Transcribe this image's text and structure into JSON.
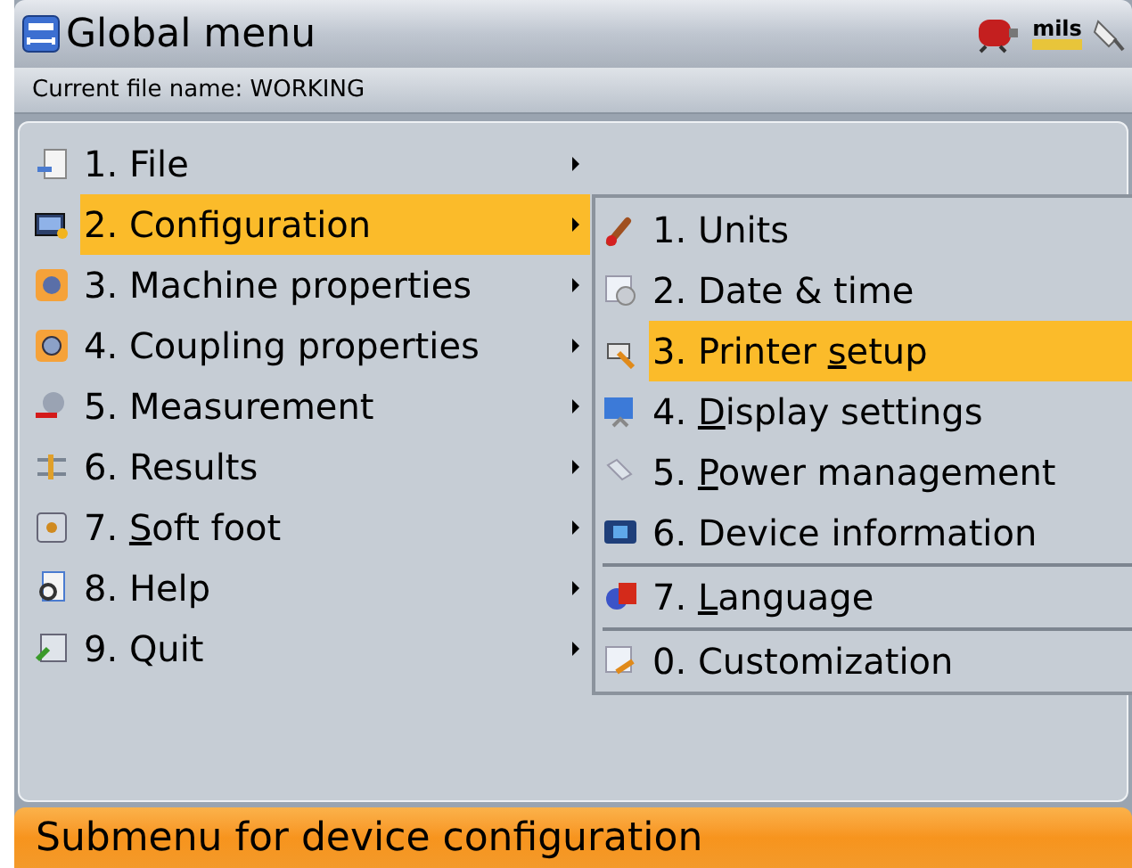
{
  "header": {
    "title": "Global menu",
    "units": "mils"
  },
  "file_line": "Current file name: WORKING",
  "menu": [
    {
      "label": "1. File",
      "selected": false
    },
    {
      "label": "2. Configuration",
      "selected": true
    },
    {
      "label": "3. Machine properties",
      "selected": false
    },
    {
      "label": "4. Coupling properties",
      "selected": false
    },
    {
      "label": "5. Measurement",
      "selected": false
    },
    {
      "label": "6. Results",
      "selected": false
    },
    {
      "before": "7. ",
      "key": "S",
      "after": "oft foot",
      "selected": false
    },
    {
      "label": "8. Help",
      "selected": false
    },
    {
      "label": "9. Quit",
      "selected": false
    }
  ],
  "submenu": [
    {
      "label": "1. Units",
      "selected": false
    },
    {
      "label": "2. Date & time",
      "selected": false
    },
    {
      "before": "3. Printer ",
      "key": "s",
      "after": "etup",
      "selected": true
    },
    {
      "before": "4. ",
      "key": "D",
      "after": "isplay settings",
      "selected": false
    },
    {
      "before": "5. ",
      "key": "P",
      "after": "ower management",
      "selected": false
    },
    {
      "label": "6. Device information",
      "selected": false,
      "separator_after": true
    },
    {
      "before": "7. ",
      "key": "L",
      "after": "anguage",
      "selected": false,
      "separator_after": true
    },
    {
      "label": "0. Customization",
      "selected": false
    }
  ],
  "status_bar": "Submenu for device configuration"
}
